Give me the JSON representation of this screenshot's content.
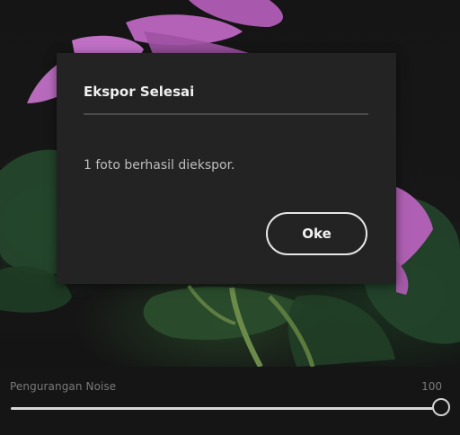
{
  "dialog": {
    "title": "Ekspor Selesai",
    "message": "1 foto berhasil diekspor.",
    "ok_label": "Oke"
  },
  "slider": {
    "label": "Pengurangan Noise",
    "value": "100",
    "fill_fraction": 1.0
  },
  "colors": {
    "petal": "#b462b8",
    "leaf": "#2c5a36",
    "dialog_bg": "#232323",
    "button_border": "#e6e6e6"
  }
}
